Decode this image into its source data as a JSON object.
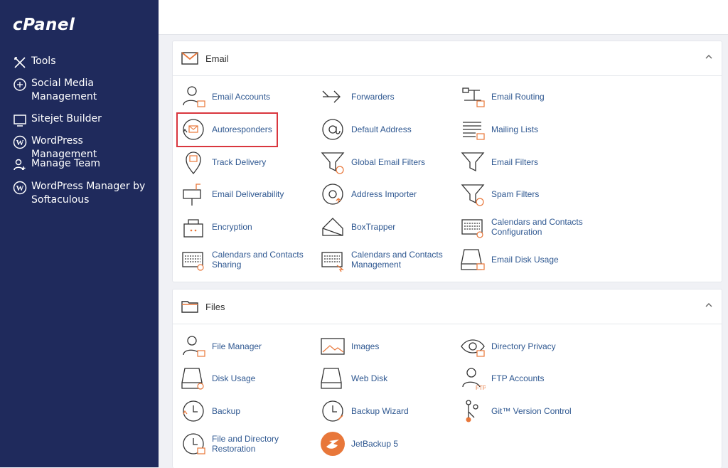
{
  "sidebar": {
    "logo": "cPanel",
    "items": [
      {
        "label": "Tools",
        "icon": "tools-icon"
      },
      {
        "label": "Social Media\nManagement",
        "icon": "social-media-icon"
      },
      {
        "label": "Sitejet Builder",
        "icon": "sitejet-icon"
      },
      {
        "label": "WordPress Management",
        "icon": "wordpress-icon"
      },
      {
        "label": "Manage Team",
        "icon": "team-icon"
      },
      {
        "label": "WordPress Manager by\nSoftaculous",
        "icon": "wordpress-icon"
      }
    ]
  },
  "email": {
    "title": "Email",
    "items": [
      {
        "label": "Email Accounts",
        "icon": "email-accounts-icon"
      },
      {
        "label": "Forwarders",
        "icon": "forwarders-icon"
      },
      {
        "label": "Email Routing",
        "icon": "email-routing-icon"
      },
      {
        "label": "Autoresponders",
        "icon": "autoresponders-icon"
      },
      {
        "label": "Default Address",
        "icon": "default-address-icon"
      },
      {
        "label": "Mailing Lists",
        "icon": "mailing-lists-icon"
      },
      {
        "label": "Track Delivery",
        "icon": "track-delivery-icon"
      },
      {
        "label": "Global Email Filters",
        "icon": "global-email-filters-icon"
      },
      {
        "label": "Email Filters",
        "icon": "email-filters-icon"
      },
      {
        "label": "Email Deliverability",
        "icon": "email-deliverability-icon"
      },
      {
        "label": "Address Importer",
        "icon": "address-importer-icon"
      },
      {
        "label": "Spam Filters",
        "icon": "spam-filters-icon"
      },
      {
        "label": "Encryption",
        "icon": "encryption-icon"
      },
      {
        "label": "BoxTrapper",
        "icon": "boxtrapper-icon"
      },
      {
        "label": "Calendars and Contacts\nConfiguration",
        "icon": "calendars-config-icon"
      },
      {
        "label": "Calendars and Contacts\nSharing",
        "icon": "calendars-sharing-icon"
      },
      {
        "label": "Calendars and Contacts\nManagement",
        "icon": "calendars-management-icon"
      },
      {
        "label": "Email Disk Usage",
        "icon": "email-disk-usage-icon"
      }
    ]
  },
  "files": {
    "title": "Files",
    "items": [
      {
        "label": "File Manager",
        "icon": "file-manager-icon"
      },
      {
        "label": "Images",
        "icon": "images-icon"
      },
      {
        "label": "Directory Privacy",
        "icon": "directory-privacy-icon"
      },
      {
        "label": "Disk Usage",
        "icon": "disk-usage-icon"
      },
      {
        "label": "Web Disk",
        "icon": "web-disk-icon"
      },
      {
        "label": "FTP Accounts",
        "icon": "ftp-accounts-icon"
      },
      {
        "label": "Backup",
        "icon": "backup-icon"
      },
      {
        "label": "Backup Wizard",
        "icon": "backup-wizard-icon"
      },
      {
        "label": "Git™ Version Control",
        "icon": "git-icon"
      },
      {
        "label": "File and Directory\nRestoration",
        "icon": "restoration-icon"
      },
      {
        "label": "JetBackup 5",
        "icon": "jetbackup-icon"
      }
    ]
  },
  "colors": {
    "sidebar_bg": "#1f2a5c",
    "accent_orange": "#e8773a",
    "link_blue": "#2f5891",
    "highlight_red": "#d9363e"
  }
}
